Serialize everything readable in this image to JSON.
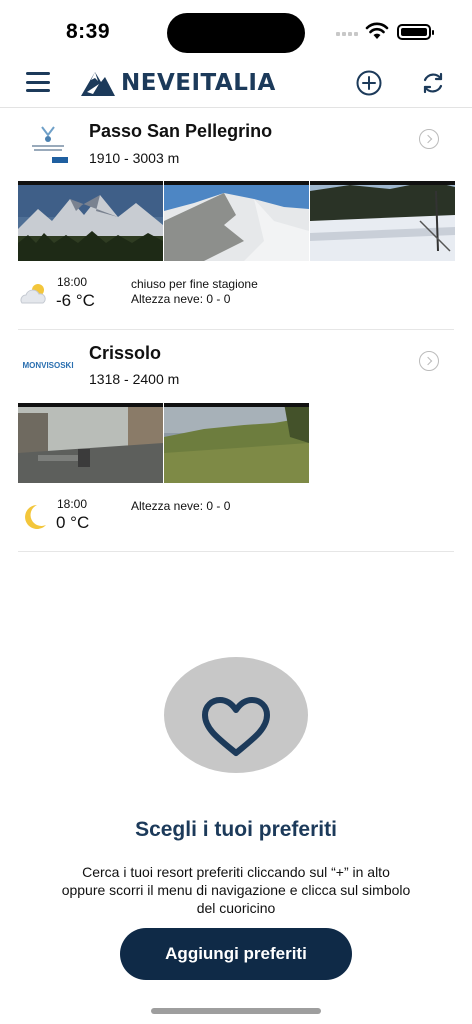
{
  "status": {
    "time": "8:39"
  },
  "header": {
    "logo_text": "NEVEITALIA",
    "menu_icon": "hamburger-icon",
    "add_icon": "plus-circle-icon",
    "refresh_icon": "refresh-icon"
  },
  "resorts": [
    {
      "name": "Passo San Pellegrino",
      "altitude": "1910 - 3003 m",
      "weather": {
        "icon": "snow-cloud-icon",
        "time": "18:00",
        "temp": "-6 °C",
        "status": "chiuso per fine stagione",
        "snow": "Altezza neve: 0 - 0"
      },
      "webcams": [
        "webcam-1",
        "webcam-2",
        "webcam-3"
      ]
    },
    {
      "name": "Crissolo",
      "logo_text": "MONVISOSKI",
      "altitude": "1318 - 2400 m",
      "weather": {
        "icon": "moon-icon",
        "time": "18:00",
        "temp": "0 °C",
        "snow": "Altezza neve: 0 - 0"
      },
      "webcams": [
        "webcam-1",
        "webcam-2"
      ]
    }
  ],
  "favorites": {
    "icon": "heart-icon",
    "title": "Scegli i tuoi preferiti",
    "description": "Cerca i tuoi resort preferiti cliccando sul “+” in alto oppure scorri il menu di navigazione e clicca sul simbolo del cuoricino",
    "button_label": "Aggiungi preferiti"
  },
  "colors": {
    "brand": "#1c3a5a",
    "button": "#0f2a47",
    "circle": "#c7c7c7"
  }
}
